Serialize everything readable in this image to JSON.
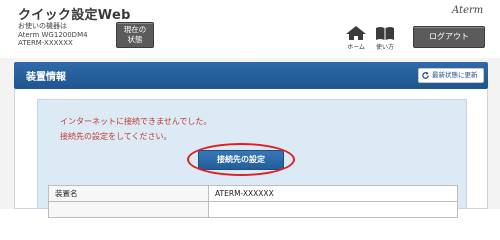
{
  "header": {
    "app_title": "クイック設定Web",
    "device_label": "お使いの機器は",
    "device_model": "Aterm WG1200DM4",
    "device_name": "ATERM-XXXXXX",
    "status_button_line1": "現在の",
    "status_button_line2": "状態",
    "brand_logo": "Aterm",
    "home_label": "ホーム",
    "help_label": "使い方",
    "logout_label": "ログアウト"
  },
  "section": {
    "title": "装置情報",
    "refresh_label": "最新状態に更新"
  },
  "alert": {
    "line1": "インターネットに接続できませんでした。",
    "line2": "接続先の設定をしてください。",
    "connect_button_label": "接続先の設定"
  },
  "info_table": {
    "rows": [
      {
        "key": "装置名",
        "value": "ATERM-XXXXXX"
      },
      {
        "key": "",
        "value": ""
      }
    ]
  },
  "colors": {
    "section_bar": "#2a63a0",
    "alert_text": "#c0392b",
    "alert_background": "#dceaf6",
    "highlight_ellipse": "#e02020",
    "dark_button": "#5b5b5b"
  }
}
